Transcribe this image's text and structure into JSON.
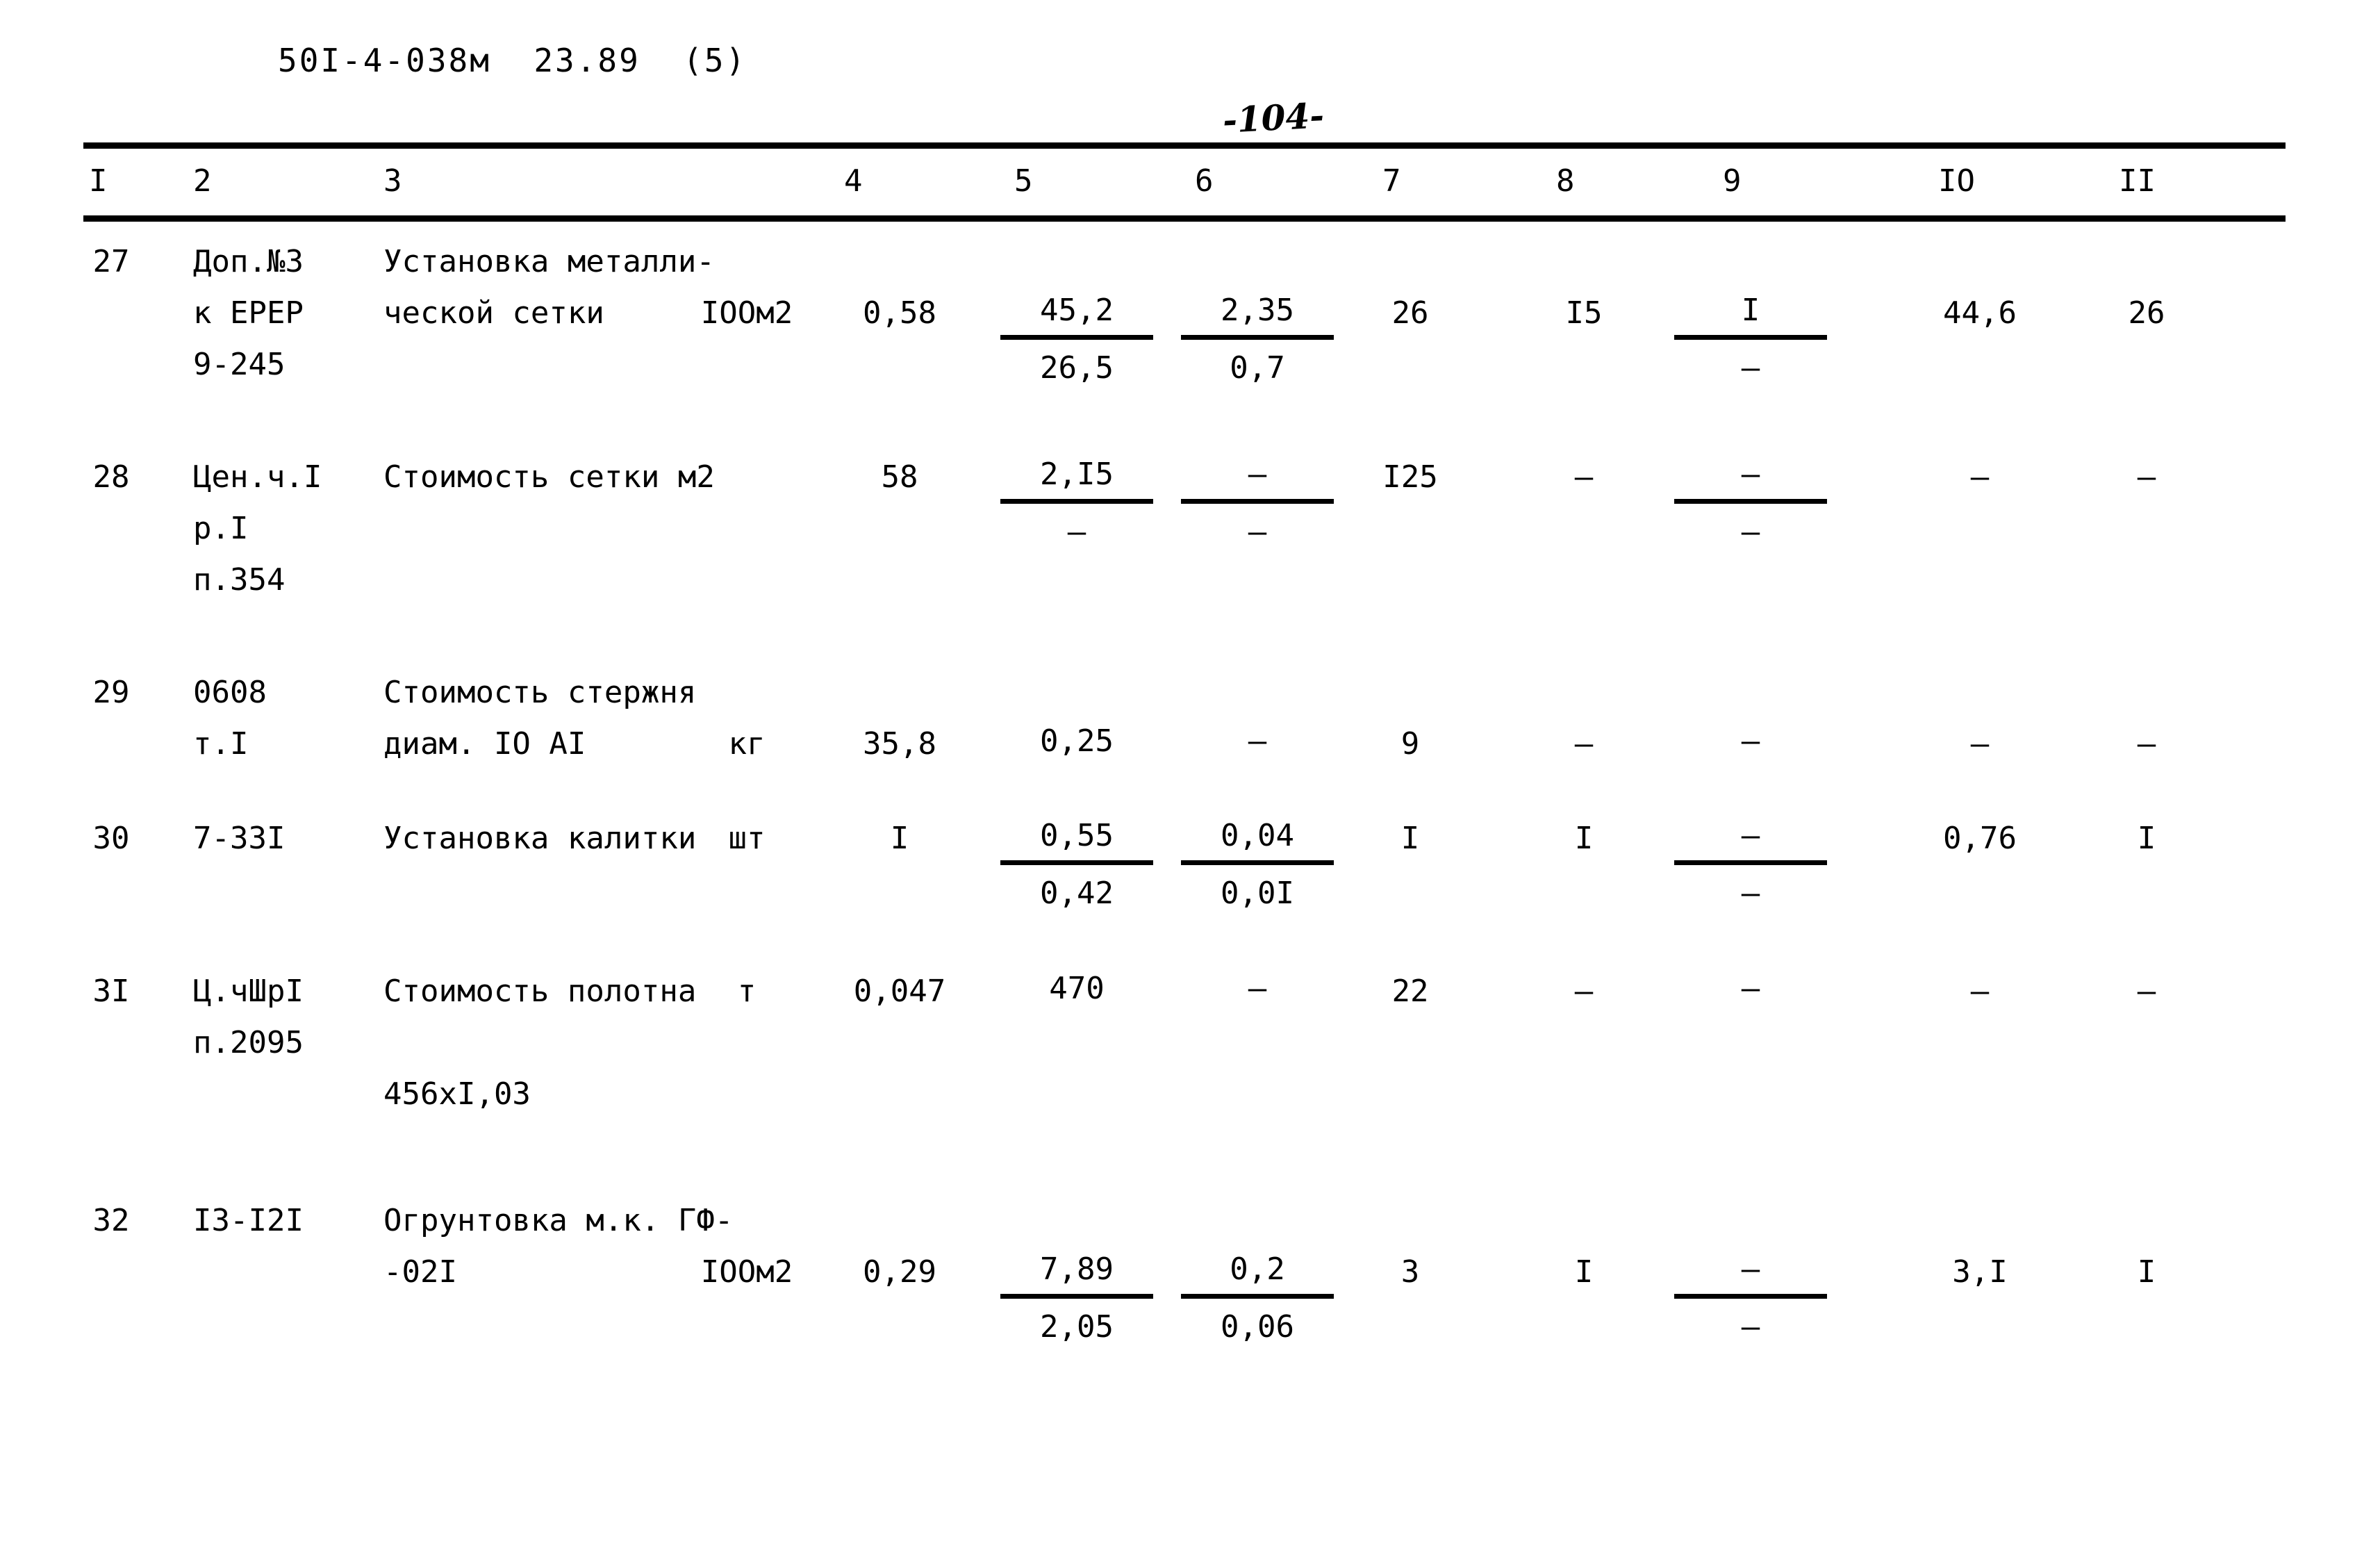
{
  "document": {
    "header_code": "50I-4-038м  23.89  (5)",
    "folio": "-104-"
  },
  "table": {
    "column_headers": [
      "I",
      "2",
      "3",
      "4",
      "5",
      "6",
      "7",
      "8",
      "9",
      "IO",
      "II"
    ],
    "rows": [
      {
        "num": "27",
        "code_lines": [
          "Доп.№3",
          "к ЕРЕР",
          "9-245"
        ],
        "desc_lines": [
          "Установка металли-",
          "ческой сетки"
        ],
        "unit": "IOOм2",
        "c4": "0,58",
        "c5": {
          "num": "45,2",
          "den": "26,5"
        },
        "c6": {
          "num": "2,35",
          "den": "0,7"
        },
        "c7": "26",
        "c8": "I5",
        "c9": {
          "num": "I",
          "den": "–"
        },
        "c10": "44,6",
        "c11": "26"
      },
      {
        "num": "28",
        "code_lines": [
          "Цен.ч.I",
          "р.I",
          "п.354"
        ],
        "desc_lines": [
          "Стоимость сетки м2"
        ],
        "unit": "",
        "c4": "58",
        "c5": {
          "num": "2,I5",
          "den": "–"
        },
        "c6": {
          "num": "–",
          "den": "–"
        },
        "c7": "I25",
        "c8": "–",
        "c9": {
          "num": "–",
          "den": "–"
        },
        "c10": "–",
        "c11": "–"
      },
      {
        "num": "29",
        "code_lines": [
          "0608",
          "т.I"
        ],
        "desc_lines": [
          "Стоимость стержня",
          "диам. IO AI"
        ],
        "unit": "кг",
        "c4": "35,8",
        "c5": {
          "num": "0,25",
          "den": ""
        },
        "c6": {
          "num": "–",
          "den": ""
        },
        "c7": "9",
        "c8": "–",
        "c9": {
          "num": "–",
          "den": ""
        },
        "c10": "–",
        "c11": "–"
      },
      {
        "num": "30",
        "code_lines": [
          "7-33I"
        ],
        "desc_lines": [
          "Установка калитки"
        ],
        "unit": "шт",
        "c4": "I",
        "c5": {
          "num": "0,55",
          "den": "0,42"
        },
        "c6": {
          "num": "0,04",
          "den": "0,0I"
        },
        "c7": "I",
        "c8": "I",
        "c9": {
          "num": "–",
          "den": "–"
        },
        "c10": "0,76",
        "c11": "I"
      },
      {
        "num": "3I",
        "code_lines": [
          "Ц.чШрI",
          "п.2095"
        ],
        "desc_lines": [
          "Стоимость полотна",
          "",
          "456хI,03"
        ],
        "unit": "т",
        "c4": "0,047",
        "c5": {
          "num": "470",
          "den": ""
        },
        "c6": {
          "num": "–",
          "den": ""
        },
        "c7": "22",
        "c8": "–",
        "c9": {
          "num": "–",
          "den": ""
        },
        "c10": "–",
        "c11": "–"
      },
      {
        "num": "32",
        "code_lines": [
          "I3-I2I"
        ],
        "desc_lines": [
          "Огрунтовка м.к. ГФ-",
          "-02I"
        ],
        "unit": "IOOм2",
        "c4": "0,29",
        "c5": {
          "num": "7,89",
          "den": "2,05"
        },
        "c6": {
          "num": "0,2",
          "den": "0,06"
        },
        "c7": "3",
        "c8": "I",
        "c9": {
          "num": "–",
          "den": "–"
        },
        "c10": "3,I",
        "c11": "I"
      }
    ]
  }
}
